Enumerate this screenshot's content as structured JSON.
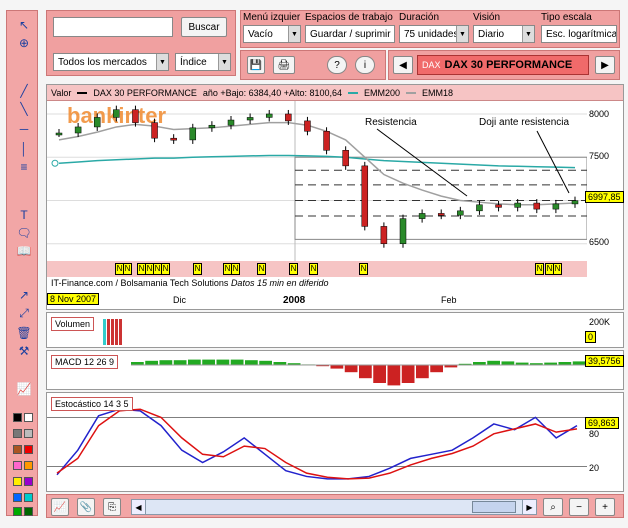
{
  "search": {
    "value": "",
    "button": "Buscar"
  },
  "markets": {
    "selected": "Todos los mercados"
  },
  "category": {
    "selected": "Índice"
  },
  "menus": {
    "menu_izq_label": "Menú izquier",
    "menu_izq_value": "Vacío",
    "espacios_label": "Espacios de trabajo",
    "espacios_value": "Guardar / suprimir",
    "duracion_label": "Duración",
    "duracion_value": "75 unidades",
    "vision_label": "Visión",
    "vision_value": "Diario",
    "escala_label": "Tipo escala",
    "escala_value": "Esc. logarítmica"
  },
  "symbol": {
    "code": "DAX",
    "name": "DAX 30 PERFORMANCE"
  },
  "price_panel": {
    "header": "Valor",
    "series_name": "DAX 30 PERFORMANCE",
    "stats": "año +Bajo: 6384,40 +Alto: 8100,64",
    "ema200": "EMM200",
    "ema18": "EMM18",
    "watermark": "bankinter",
    "annotation1": "Resistencia",
    "annotation2": "Doji ante resistencia",
    "last_price": "6997,85",
    "y_ticks": [
      "8000",
      "7500",
      "7000",
      "6500"
    ],
    "markers": [
      "N",
      "N",
      "N",
      "N",
      "N",
      "N",
      "N",
      "N",
      "N",
      "N",
      "N",
      "N",
      "N",
      "N",
      "N",
      "N"
    ],
    "credit": "IT-Finance.com / Bolsamania Tech Solutions",
    "credit_note": "Datos 15 min en diferido",
    "date_badge": "8 Nov 2007",
    "x_labels": [
      "Dic",
      "2008",
      "Feb"
    ]
  },
  "volume_panel": {
    "title": "Volumen",
    "tick": "200K",
    "zero": "0"
  },
  "macd_panel": {
    "title": "MACD 12 26 9",
    "value": "39,5756"
  },
  "stoch_panel": {
    "title": "Estocástico 14 3 5",
    "value": "69,863",
    "tick_hi": "80",
    "tick_lo": "20"
  },
  "colors": {
    "accent": "#f0a0a0",
    "price_line": "#000000",
    "ema200": "#2aa9a6",
    "ema18": "#a0a0a0",
    "stoch_k": "#2222cc",
    "stoch_d": "#dd1111",
    "macd": "#22aa22"
  },
  "chart_data": [
    {
      "type": "line",
      "title": "DAX 30 PERFORMANCE",
      "x": [
        "Nov",
        "Dic",
        "2008",
        "Feb"
      ],
      "ylim": [
        6300,
        8150
      ],
      "series": [
        {
          "name": "DAX 30 PERFORMANCE",
          "values": [
            7780,
            7850,
            7960,
            8050,
            7900,
            7720,
            7700,
            7840,
            7870,
            7930,
            7960,
            8000,
            7920,
            7800,
            7580,
            7400,
            6700,
            6500,
            6790,
            6850,
            6830,
            6880,
            6950,
            6920,
            6970,
            6900,
            6960,
            6998
          ]
        },
        {
          "name": "EMM200",
          "values": [
            7430,
            7445,
            7460,
            7470,
            7480,
            7490,
            7490,
            7500,
            7505,
            7510,
            7515,
            7520,
            7520,
            7515,
            7510,
            7500,
            7480,
            7460,
            7450,
            7440,
            7430,
            7420,
            7410,
            7400,
            7395,
            7390,
            7385,
            7380
          ]
        },
        {
          "name": "EMM18",
          "values": [
            7700,
            7740,
            7790,
            7850,
            7880,
            7860,
            7820,
            7830,
            7840,
            7860,
            7880,
            7900,
            7900,
            7870,
            7800,
            7700,
            7500,
            7300,
            7200,
            7120,
            7050,
            7000,
            6980,
            6960,
            6950,
            6950,
            6960,
            6970
          ]
        }
      ]
    },
    {
      "type": "line",
      "title": "Estocástico 14 3 5",
      "ylim": [
        0,
        100
      ],
      "series": [
        {
          "name": "K",
          "values": [
            10,
            40,
            82,
            90,
            88,
            70,
            40,
            25,
            38,
            55,
            35,
            15,
            8,
            5,
            5,
            8,
            18,
            30,
            35,
            40,
            55,
            72,
            65,
            80,
            55,
            70
          ]
        },
        {
          "name": "D",
          "values": [
            12,
            30,
            70,
            88,
            90,
            80,
            55,
            35,
            32,
            45,
            42,
            25,
            12,
            7,
            5,
            6,
            12,
            22,
            30,
            36,
            45,
            60,
            66,
            72,
            62,
            66
          ]
        }
      ]
    },
    {
      "type": "bar",
      "title": "MACD 12 26 9",
      "values": [
        5,
        7,
        8,
        8,
        9,
        9,
        9,
        9,
        8,
        7,
        5,
        3,
        1,
        -2,
        -6,
        -12,
        -22,
        -30,
        -34,
        -30,
        -22,
        -12,
        -4,
        2,
        5,
        7,
        6,
        4,
        3,
        4,
        5,
        6
      ]
    }
  ]
}
